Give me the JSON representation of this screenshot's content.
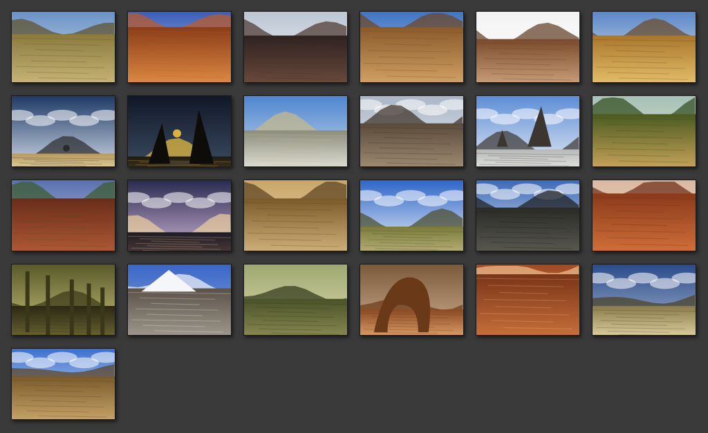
{
  "gallery": {
    "background": "#3a3a3a",
    "thumbnails": [
      {
        "theme": "desert-hill",
        "sky": [
          "#6a92c8",
          "#d8e2ea"
        ],
        "ground": [
          "#8a7a3e",
          "#c9b577"
        ],
        "accent": "#5c4f26"
      },
      {
        "theme": "red-canyon",
        "sky": [
          "#3a5db8",
          "#c6d4ea"
        ],
        "ground": [
          "#8a3d18",
          "#e08a45"
        ],
        "accent": "#c05a22"
      },
      {
        "theme": "dark-canyon",
        "sky": [
          "#bcc7d4",
          "#eef1f4"
        ],
        "ground": [
          "#2e2220",
          "#6b4a3c"
        ],
        "accent": "#4a332b"
      },
      {
        "theme": "sand-plain",
        "sky": [
          "#3f74c4",
          "#b9cbe2"
        ],
        "ground": [
          "#8a5a2a",
          "#d2a266"
        ],
        "accent": "#6e4420"
      },
      {
        "theme": "cliff-sun",
        "sky": [
          "#f2f3f2",
          "#ffffff"
        ],
        "ground": [
          "#7a4a2a",
          "#caa07a"
        ],
        "accent": "#5e3a22"
      },
      {
        "theme": "dune-mountain",
        "sky": [
          "#5b86c8",
          "#e4ecf4"
        ],
        "ground": [
          "#a8762c",
          "#e6c06a"
        ],
        "accent": "#6b4824"
      },
      {
        "theme": "lone-tree-plain",
        "sky": [
          "#1f3a66",
          "#c9d4e2"
        ],
        "ground": [
          "#b89a5a",
          "#e2cfa0"
        ],
        "accent": "#2b2b2b"
      },
      {
        "theme": "night-rock",
        "sky": [
          "#111827",
          "#3a4a60"
        ],
        "ground": [
          "#1e1a12",
          "#3e3320"
        ],
        "accent": "#f0c040"
      },
      {
        "theme": "rocky-valley",
        "sky": [
          "#4f86d0",
          "#c6d7ea"
        ],
        "ground": [
          "#8c8c7c",
          "#e0e0d6"
        ],
        "accent": "#c9b98a"
      },
      {
        "theme": "boulder-field",
        "sky": [
          "#a9b6c6",
          "#e6e9ee"
        ],
        "ground": [
          "#5a4a3a",
          "#a08c74"
        ],
        "accent": "#3a2e22"
      },
      {
        "theme": "sea-stack",
        "sky": [
          "#5d8dd6",
          "#dfe7f2"
        ],
        "ground": [
          "#b7b9b8",
          "#e2e3e0"
        ],
        "accent": "#3c3630"
      },
      {
        "theme": "green-dunes",
        "sky": [
          "#a6c1b8",
          "#e0e3c8"
        ],
        "ground": [
          "#4a5a20",
          "#c9a45a"
        ],
        "accent": "#2e4a1a"
      },
      {
        "theme": "red-mountains",
        "sky": [
          "#5a70b0",
          "#c0cbe0"
        ],
        "ground": [
          "#6a2c1a",
          "#b05a34"
        ],
        "accent": "#3a5a2a"
      },
      {
        "theme": "dusk-clouds",
        "sky": [
          "#2a2a50",
          "#c8b0d0"
        ],
        "ground": [
          "#1e1c24",
          "#4a3a3a"
        ],
        "accent": "#f0d0a0"
      },
      {
        "theme": "sand-haze",
        "sky": [
          "#c9a66a",
          "#e8d6a8"
        ],
        "ground": [
          "#7a5a2a",
          "#d2b27a"
        ],
        "accent": "#5a4020"
      },
      {
        "theme": "cloud-plateau",
        "sky": [
          "#2f66c8",
          "#e8eef8"
        ],
        "ground": [
          "#7a7a3a",
          "#b8b07a"
        ],
        "accent": "#4a4a26"
      },
      {
        "theme": "dark-flat",
        "sky": [
          "#3c6ab8",
          "#dfe6ef"
        ],
        "ground": [
          "#2a2a26",
          "#5a5a52"
        ],
        "accent": "#1a1a18"
      },
      {
        "theme": "red-desert",
        "sky": [
          "#d9b8a0",
          "#f0e0d0"
        ],
        "ground": [
          "#8a3a1a",
          "#d2703a"
        ],
        "accent": "#6a2a14"
      },
      {
        "theme": "rock-spires-fog",
        "sky": [
          "#5a5a2a",
          "#c8c27a"
        ],
        "ground": [
          "#2a2814",
          "#6a6432"
        ],
        "accent": "#3a3618"
      },
      {
        "theme": "snow-peak",
        "sky": [
          "#3a66c8",
          "#8aa6d8"
        ],
        "ground": [
          "#5a5248",
          "#a09a8e"
        ],
        "accent": "#f4f6fa"
      },
      {
        "theme": "green-hill",
        "sky": [
          "#9ea870",
          "#e0dcae"
        ],
        "ground": [
          "#4a5228",
          "#8a8a52"
        ],
        "accent": "#2e3418"
      },
      {
        "theme": "stone-arch",
        "sky": [
          "#7a5a3a",
          "#d0b090"
        ],
        "ground": [
          "#8a4a22",
          "#e0a06a"
        ],
        "accent": "#6a3a18"
      },
      {
        "theme": "layered-canyon",
        "sky": [
          "#a04a22",
          "#e0a070"
        ],
        "ground": [
          "#7a3418",
          "#c8703a"
        ],
        "accent": "#f0c090"
      },
      {
        "theme": "pebble-plain",
        "sky": [
          "#2a4a8a",
          "#a8b8d0"
        ],
        "ground": [
          "#8a7a4a",
          "#e0d2a0"
        ],
        "accent": "#4a3e22"
      },
      {
        "theme": "cloud-desert",
        "sky": [
          "#3a70d0",
          "#eef2f8"
        ],
        "ground": [
          "#7a5a2a",
          "#c9a56a"
        ],
        "accent": "#5a4020"
      }
    ]
  }
}
